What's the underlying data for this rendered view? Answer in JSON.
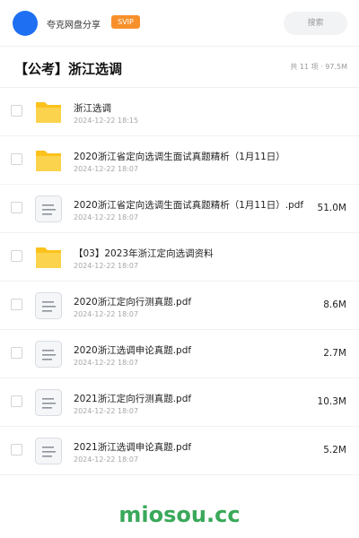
{
  "header": {
    "share_title": "夸克网盘分享",
    "badge": "SVIP",
    "search_placeholder": "搜索"
  },
  "folder": {
    "title": "【公考】浙江选调",
    "meta": "共 11 项 · 97.5M"
  },
  "colors": {
    "accent": "#1e6ff2",
    "badge": "#f7902b",
    "folder_icon": "#fbc21b",
    "watermark": "#3aa85a"
  },
  "files": [
    {
      "name": "浙江选调",
      "date": "2024-12-22 18:15",
      "size": "",
      "icon": "folder-icon"
    },
    {
      "name": "2020浙江省定向选调生面试真题精析（1月11日）",
      "date": "2024-12-22 18:07",
      "size": "",
      "icon": "folder-icon"
    },
    {
      "name": "2020浙江省定向选调生面试真题精析（1月11日）.pdf",
      "date": "2024-12-22 18:07",
      "size": "51.0M",
      "icon": "document-icon"
    },
    {
      "name": "【03】2023年浙江定向选调资料",
      "date": "2024-12-22 18:07",
      "size": "",
      "icon": "folder-icon"
    },
    {
      "name": "2020浙江定向行测真题.pdf",
      "date": "2024-12-22 18:07",
      "size": "8.6M",
      "icon": "document-icon"
    },
    {
      "name": "2020浙江选调申论真题.pdf",
      "date": "2024-12-22 18:07",
      "size": "2.7M",
      "icon": "document-icon"
    },
    {
      "name": "2021浙江定向行测真题.pdf",
      "date": "2024-12-22 18:07",
      "size": "10.3M",
      "icon": "document-icon"
    },
    {
      "name": "2021浙江选调申论真题.pdf",
      "date": "2024-12-22 18:07",
      "size": "5.2M",
      "icon": "document-icon"
    }
  ],
  "watermark": "miosou.cc"
}
